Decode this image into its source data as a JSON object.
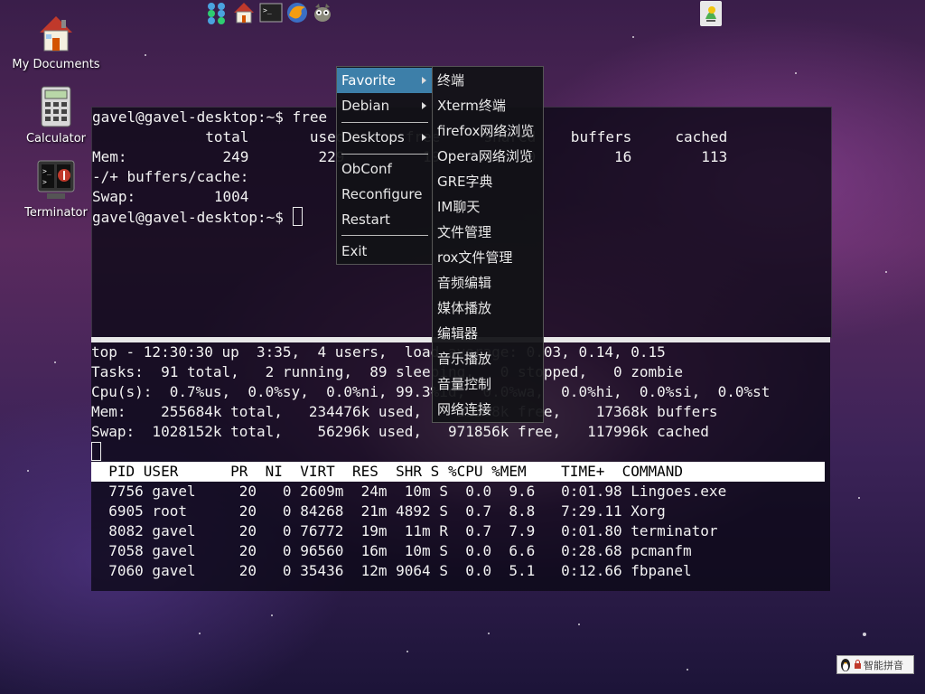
{
  "desktop": {
    "icons": [
      {
        "label": "My Documents"
      },
      {
        "label": "Calculator"
      },
      {
        "label": "Terminator"
      }
    ]
  },
  "panel": {
    "launchers": [
      "apps-grid-icon",
      "home-folder-icon",
      "terminal-icon",
      "firefox-icon",
      "gimp-icon"
    ],
    "tray_icon": "notification-icon"
  },
  "terminal_free": {
    "lines": [
      "gavel@gavel-desktop:~$ free",
      "             total       used       free     shared    buffers     cached",
      "Mem:           249        229         19          0         16        113",
      "-/+ buffers/cache:",
      "Swap:         1004",
      "gavel@gavel-desktop:~$ "
    ]
  },
  "terminal_top": {
    "lines": [
      "top - 12:30:30 up  3:35,  4 users,  load average: 0.03, 0.14, 0.15",
      "Tasks:  91 total,   2 running,  89 sleeping,   0 stopped,   0 zombie",
      "Cpu(s):  0.7%us,  0.0%sy,  0.0%ni, 99.3%id,  0.0%wa,  0.0%hi,  0.0%si,  0.0%st",
      "Mem:    255684k total,   234476k used,    21208k free,    17368k buffers",
      "Swap:  1028152k total,    56296k used,   971856k free,   117996k cached"
    ],
    "header": "  PID USER      PR  NI  VIRT  RES  SHR S %CPU %MEM    TIME+  COMMAND",
    "rows": [
      "  7756 gavel     20   0 2609m  24m  10m S  0.0  9.6   0:01.98 Lingoes.exe",
      "  6905 root      20   0 84268  21m 4892 S  0.7  8.8   7:29.11 Xorg",
      "  8082 gavel     20   0 76772  19m  11m R  0.7  7.9   0:01.80 terminator",
      "  7058 gavel     20   0 96560  16m  10m S  0.0  6.6   0:28.68 pcmanfm",
      "  7060 gavel     20   0 35436  12m 9064 S  0.0  5.1   0:12.66 fbpanel"
    ]
  },
  "menu_main": {
    "items": [
      "Favorite",
      "Debian",
      "Desktops",
      "ObConf",
      "Reconfigure",
      "Restart",
      "Exit"
    ]
  },
  "menu_sub": {
    "items": [
      "终端",
      "Xterm终端",
      "firefox网络浏览",
      "Opera网络浏览",
      "GRE字典",
      "IM聊天",
      "文件管理",
      "rox文件管理",
      "音频编辑",
      "媒体播放",
      "编辑器",
      "音乐播放",
      "音量控制",
      "网络连接"
    ]
  },
  "tray": {
    "ime_label": "智能拼音"
  },
  "colors": {
    "menu_highlight": "#3d7fa9",
    "terminal_bg": "#0a0814",
    "menu_bg": "#121216"
  }
}
